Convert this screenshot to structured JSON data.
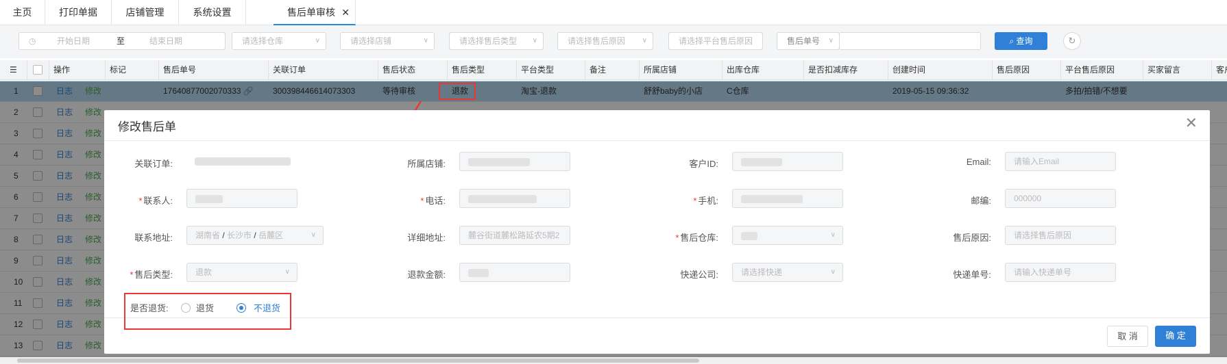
{
  "tabs": [
    {
      "label": "主页"
    },
    {
      "label": "打印单据"
    },
    {
      "label": "店铺管理"
    },
    {
      "label": "系统设置"
    },
    {
      "label": "售后单审核",
      "close": "✕"
    }
  ],
  "filters": {
    "start_date": "开始日期",
    "date_sep": "至",
    "end_date": "结束日期",
    "warehouse": "请选择仓库",
    "shop": "请选择店铺",
    "aftersale_type": "请选择售后类型",
    "aftersale_reason": "请选择售后原因",
    "platform_reason": "请选择平台售后原因",
    "order_no_select": "售后单号",
    "search_label": "查询",
    "search_icon": "search-icon",
    "refresh_icon": "refresh-icon"
  },
  "grid": {
    "headers": [
      "操作",
      "标记",
      "售后单号",
      "关联订单",
      "售后状态",
      "售后类型",
      "平台类型",
      "备注",
      "所属店铺",
      "出库仓库",
      "是否扣减库存",
      "创建时间",
      "售后原因",
      "平台售后原因",
      "买家留言",
      "客户"
    ],
    "row_numbers": [
      "1",
      "2",
      "3",
      "4",
      "5",
      "6",
      "7",
      "8",
      "9",
      "10",
      "11",
      "12",
      "13"
    ],
    "row_links": {
      "log": "日志",
      "edit": "修改"
    },
    "first_row": {
      "aftersale_no": "17640877002070333",
      "order_no": "300398446614073303",
      "status": "等待审核",
      "type": "退款",
      "platform": "淘宝-退款",
      "shop": "舒舒baby的小店",
      "warehouse": "C仓库",
      "created": "2019-05-15 09:36:32",
      "platform_reason": "多拍/拍错/不想要"
    }
  },
  "modal": {
    "title": "修改售后单",
    "close": "✕",
    "labels": {
      "order": "关联订单:",
      "shop": "所属店铺:",
      "customer_id": "客户ID:",
      "email": "Email:",
      "contact": "联系人:",
      "phone": "电话:",
      "mobile": "手机:",
      "zip": "邮编:",
      "address": "联系地址:",
      "detail_address": "详细地址:",
      "warehouse": "售后仓库:",
      "reason": "售后原因:",
      "type": "售后类型:",
      "refund_amount": "退款金额:",
      "express_company": "快递公司:",
      "express_no": "快递单号:",
      "return_goods": "是否退货:"
    },
    "required_mark": "*",
    "values": {
      "email_placeholder": "请输入Email",
      "zip_placeholder": "000000",
      "province": "湖南省",
      "city": "长沙市",
      "district": "岳麓区",
      "region_sep": "/",
      "detail_address": "麓谷街道麓松路延农5期2",
      "reason_placeholder": "请选择售后原因",
      "type_value": "退款",
      "express_placeholder": "请选择快递",
      "express_no_placeholder": "请输入快递单号"
    },
    "radio": {
      "return": "退货",
      "no_return": "不退货",
      "selected": "不退货"
    },
    "buttons": {
      "cancel": "取 消",
      "ok": "确 定"
    }
  },
  "colors": {
    "accent": "#2f80d6",
    "annotation": "#e53935",
    "selected_row": "#b9dbf5"
  }
}
